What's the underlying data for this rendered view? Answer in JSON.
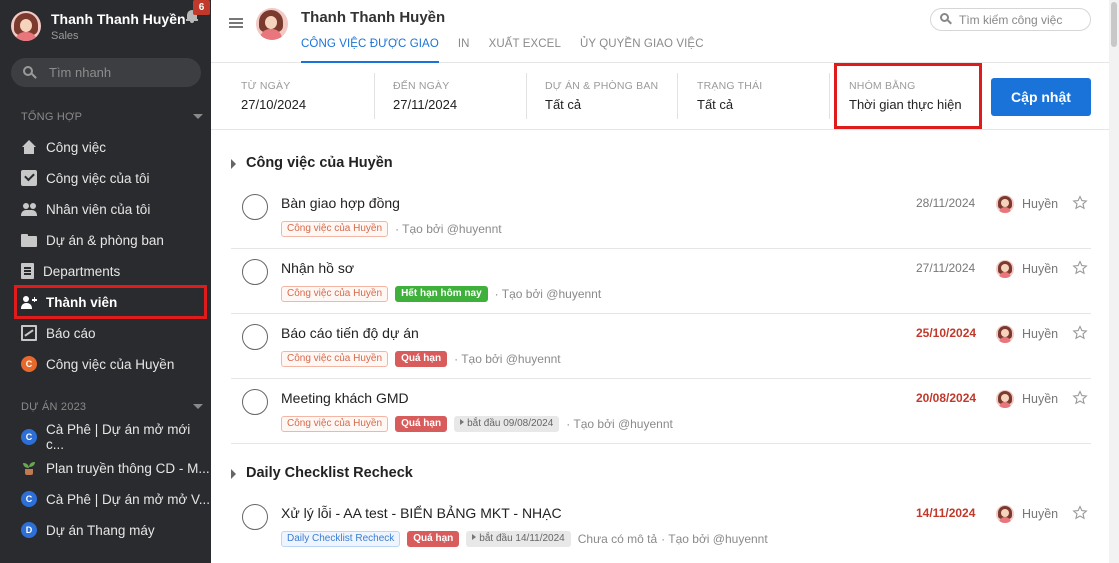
{
  "sidebar": {
    "user_name": "Thanh Thanh Huyền",
    "user_role": "Sales",
    "notification_count": "6",
    "search_placeholder": "Tìm nhanh",
    "section_general": "TỔNG HỢP",
    "items": [
      {
        "label": "Công việc",
        "icon": "home-icon"
      },
      {
        "label": "Công việc của tôi",
        "icon": "checkbox-icon"
      },
      {
        "label": "Nhân viên của tôi",
        "icon": "users-icon"
      },
      {
        "label": "Dự án & phòng ban",
        "icon": "folder-icon"
      },
      {
        "label": "Departments",
        "icon": "document-icon"
      },
      {
        "label": "Thành viên",
        "icon": "member-icon"
      },
      {
        "label": "Báo cáo",
        "icon": "chart-icon"
      },
      {
        "label": "Công việc của Huyền",
        "icon_letter": "C",
        "icon_color": "#e8692c"
      }
    ],
    "section_projects": "DỰ ÁN 2023",
    "projects": [
      {
        "label": "Cà Phê | Dự án mở mới c...",
        "icon_letter": "C",
        "icon_color": "#2d6fd6"
      },
      {
        "label": "Plan truyền thông CD - M...",
        "icon": "plant-icon"
      },
      {
        "label": "Cà Phê | Dự án mở mở V...",
        "icon_letter": "C",
        "icon_color": "#2d6fd6"
      },
      {
        "label": "Dự án Thang máy",
        "icon_letter": "D",
        "icon_color": "#2d6fd6"
      }
    ]
  },
  "header": {
    "title": "Thanh Thanh Huyền",
    "tabs": [
      "CÔNG VIỆC ĐƯỢC GIAO",
      "IN",
      "XUẤT EXCEL",
      "ỦY QUYỀN GIAO VIỆC"
    ],
    "active_tab": 0,
    "search_placeholder": "Tìm kiếm công việc"
  },
  "filters": {
    "from_label": "TỪ NGÀY",
    "from_value": "27/10/2024",
    "to_label": "ĐẾN NGÀY",
    "to_value": "27/11/2024",
    "project_label": "DỰ ÁN & PHÒNG BAN",
    "project_value": "Tất cả",
    "status_label": "TRẠNG THÁI",
    "status_value": "Tất cả",
    "group_label": "NHÓM BẰNG",
    "group_value": "Thời gian thực hiện",
    "update_button": "Cập nhật"
  },
  "groups": [
    {
      "title": "Công việc của Huyền",
      "tasks": [
        {
          "title": "Bàn giao hợp đồng",
          "project_tag": "Công việc của Huyền",
          "created_by": "· Tạo bởi @huyennt",
          "date": "28/11/2024",
          "assignee": "Huyền"
        },
        {
          "title": "Nhận hồ sơ",
          "project_tag": "Công việc của Huyền",
          "status_tag": "Hết hạn hôm nay",
          "created_by": "· Tạo bởi @huyennt",
          "date": "27/11/2024",
          "assignee": "Huyền"
        },
        {
          "title": "Báo cáo tiến độ dự án",
          "project_tag": "Công việc của Huyền",
          "status_tag": "Quá hạn",
          "created_by": "· Tạo bởi @huyennt",
          "date": "25/10/2024",
          "assignee": "Huyền"
        },
        {
          "title": "Meeting khách GMD",
          "project_tag": "Công việc của Huyền",
          "status_tag": "Quá hạn",
          "start_tag": "bắt đầu 09/08/2024",
          "created_by": "· Tạo bởi @huyennt",
          "date": "20/08/2024",
          "assignee": "Huyền"
        }
      ]
    },
    {
      "title": "Daily Checklist Recheck",
      "tasks": [
        {
          "title": "Xử lý lỗi - AA test - BIỂN BẢNG MKT - NHẠC",
          "project_tag": "Daily Checklist Recheck",
          "status_tag": "Quá hạn",
          "start_tag": "bắt đầu 14/11/2024",
          "description": "Chưa có mô tả",
          "created_by": "· Tạo bởi @huyennt",
          "date": "14/11/2024",
          "assignee": "Huyền"
        }
      ]
    }
  ],
  "colors": {
    "sidebar_bg": "#2a2b2e",
    "accent": "#1a73d9",
    "overdue": "#d85c5c",
    "due_today": "#3fb03b",
    "highlight": "#e01b1b"
  }
}
